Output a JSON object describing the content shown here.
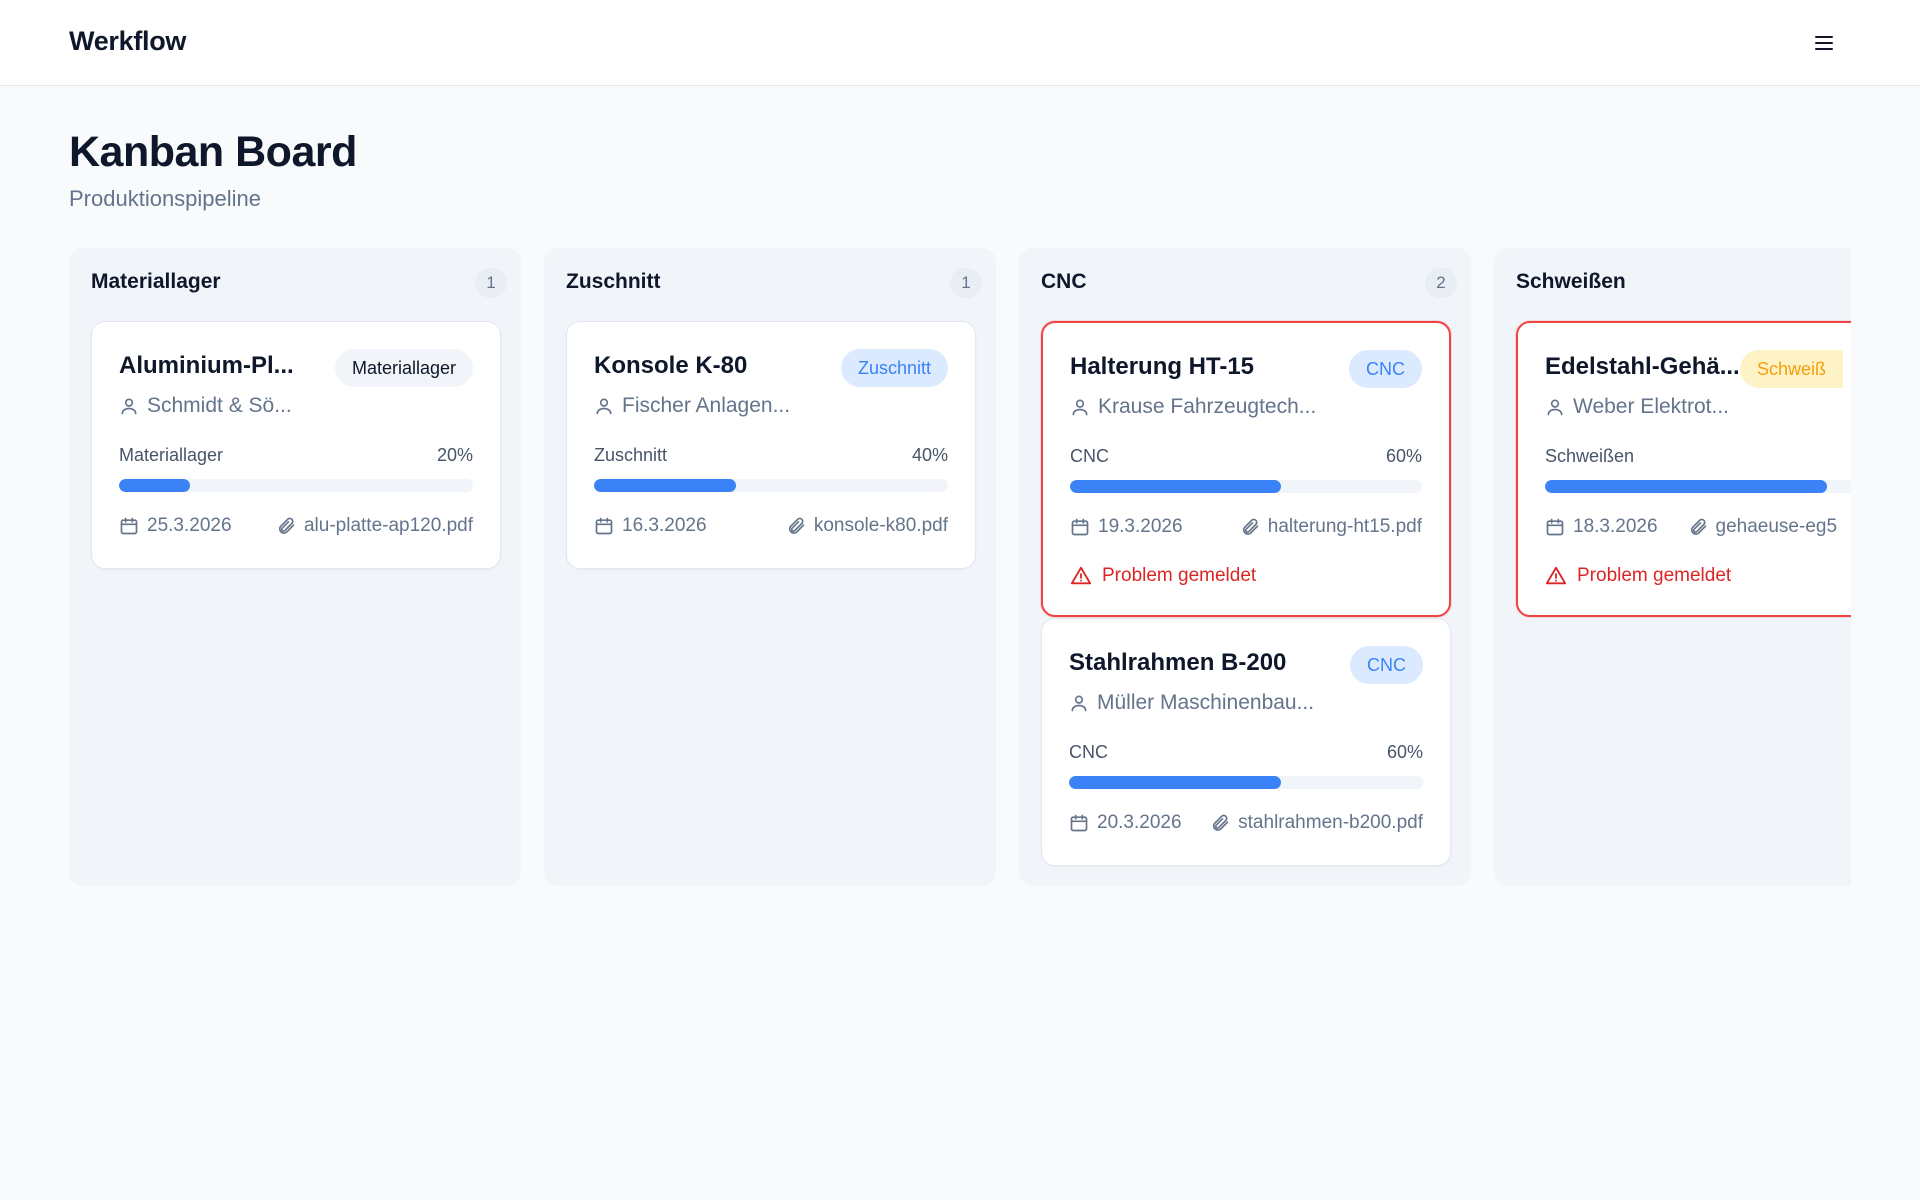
{
  "app": {
    "brand": "Werkflow",
    "menu_icon": "menu-icon"
  },
  "page": {
    "title": "Kanban Board",
    "subtitle": "Produktionspipeline"
  },
  "colors": {
    "accent": "#3b82f6",
    "danger": "#ef4444",
    "warning": "#f59e0b"
  },
  "columns": [
    {
      "title": "Materiallager",
      "count": "1",
      "cards": [
        {
          "title": "Aluminium-Pl...",
          "badge": "Materiallager",
          "customer": "Schmidt & Sö...",
          "stage": "Materiallager",
          "progress_label": "20%",
          "progress": 0.2,
          "date": "25.3.2026",
          "file": "alu-platte-ap120.pdf"
        }
      ]
    },
    {
      "title": "Zuschnitt",
      "count": "1",
      "cards": [
        {
          "title": "Konsole K-80",
          "badge": "Zuschnitt",
          "customer": "Fischer Anlagen...",
          "stage": "Zuschnitt",
          "progress_label": "40%",
          "progress": 0.4,
          "date": "16.3.2026",
          "file": "konsole-k80.pdf"
        }
      ]
    },
    {
      "title": "CNC",
      "count": "2",
      "cards": [
        {
          "title": "Halterung HT-15",
          "badge": "CNC",
          "customer": "Krause Fahrzeugtech...",
          "stage": "CNC",
          "progress_label": "60%",
          "progress": 0.6,
          "date": "19.3.2026",
          "file": "halterung-ht15.pdf",
          "problem": "Problem gemeldet"
        },
        {
          "title": "Stahlrahmen B-200",
          "badge": "CNC",
          "customer": "Müller Maschinenbau...",
          "stage": "CNC",
          "progress_label": "60%",
          "progress": 0.6,
          "date": "20.3.2026",
          "file": "stahlrahmen-b200.pdf"
        }
      ]
    },
    {
      "title": "Schweißen",
      "cards": [
        {
          "title": "Edelstahl-Gehä...",
          "badge": "Schweiß",
          "customer": "Weber Elektrot...",
          "stage": "Schweißen",
          "progress": 0.8,
          "date": "18.3.2026",
          "file": "gehaeuse-eg5",
          "problem": "Problem gemeldet"
        }
      ]
    }
  ]
}
